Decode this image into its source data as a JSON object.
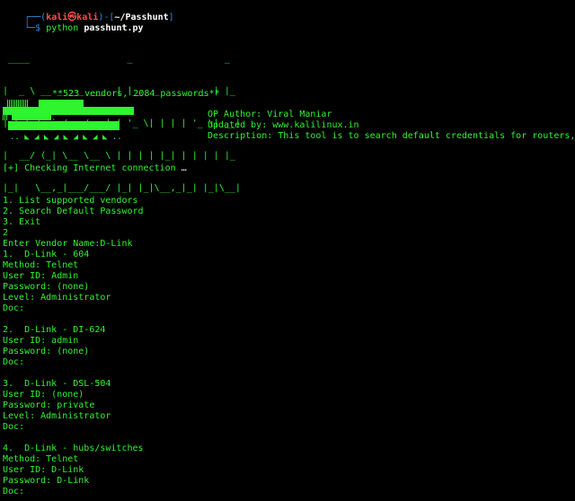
{
  "prompt": {
    "frame_top": "┌──(",
    "user": "kali㉿kali",
    "sep": ")-[",
    "dir": "~/Passhunt",
    "frame_end": "]",
    "frame_bottom": "└─$ ",
    "command": "python",
    "argument": "passhunt.py"
  },
  "banner": {
    "ascii": [
      " ____                  _                 _   ",
      "|  _ \\ __ _ ___ ___  | |__  _   _ _ __ | |_ ",
      "| |_) / _` / __/ __| | '_ \\| | | | '_ \\| __|",
      "|  __/ (_| \\__ \\__ \\ | | | | |_| | | | | |_ ",
      "|_|   \\__,_|___/___/ |_| |_|\\__,_|_| |_|\\__|"
    ],
    "subtitle": "**523 vendors, 2084 passwords**",
    "waves": ".. ◣ ◢ ◣ ◢ ◣ ◢ ◣ ◢ ◣ .."
  },
  "meta": {
    "author": "OP Author: Viral Maniar",
    "updated": "Updated by: www.kalilinux.in",
    "description": "Description: This tool is to search default credentials for routers, network devices, web applications and more."
  },
  "output": {
    "checking": "[+] Checking Internet connection",
    "ellipsis": "…",
    "menu": [
      "1. List supported vendors",
      "2. Search Default Password",
      "3. Exit"
    ],
    "choice": "2",
    "vendor_prompt": "Enter Vendor Name:D-Link",
    "results": [
      {
        "title": "1.  D-Link - 604",
        "lines": [
          "Method: Telnet",
          "User ID: Admin",
          "Password: (none)",
          "Level: Administrator",
          "Doc:"
        ]
      },
      {
        "title": "2.  D-Link - DI-624",
        "lines": [
          "User ID: admin",
          "Password: (none)",
          "Doc:"
        ]
      },
      {
        "title": "3.  D-Link - DSL-504",
        "lines": [
          "User ID: (none)",
          "Password: private",
          "Level: Administrator",
          "Doc:"
        ]
      },
      {
        "title": "4.  D-Link - hubs/switches",
        "lines": [
          "Method: Telnet",
          "User ID: D-Link",
          "Password: D-Link",
          "Doc:"
        ]
      }
    ]
  },
  "colors": {
    "background": "#000000",
    "text": "#2ef52e",
    "prompt_frame": "#2f8dde",
    "prompt_user": "#ff4d4d",
    "prompt_dir": "#ffffff"
  }
}
